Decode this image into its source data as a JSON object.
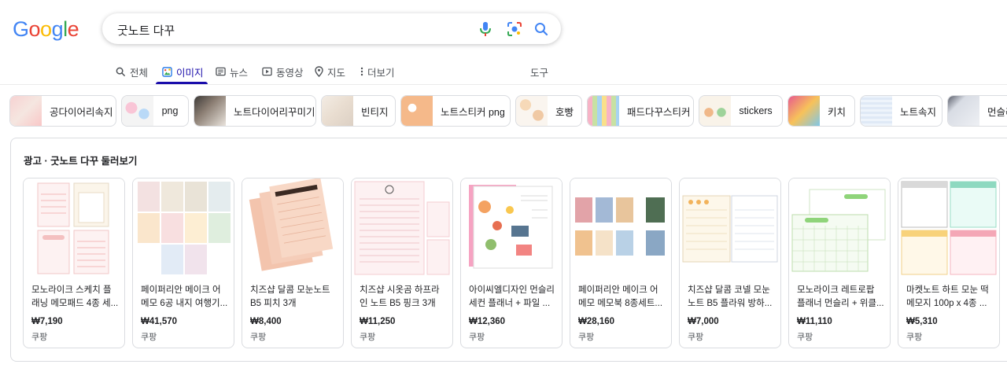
{
  "logo": {
    "text": "Google"
  },
  "search": {
    "query": "굿노트 다꾸"
  },
  "icons": {
    "mic": "microphone-icon",
    "lens": "camera-lens-icon",
    "search": "search-icon"
  },
  "tabs": [
    {
      "label": "전체",
      "icon": "search-icon"
    },
    {
      "label": "이미지",
      "icon": "image-icon",
      "active": true
    },
    {
      "label": "뉴스",
      "icon": "news-icon"
    },
    {
      "label": "동영상",
      "icon": "video-icon"
    },
    {
      "label": "지도",
      "icon": "map-pin-icon"
    },
    {
      "label": "더보기",
      "icon": "more-vert-icon"
    }
  ],
  "tools_label": "도구",
  "chips": [
    {
      "label": "공다이어리속지"
    },
    {
      "label": "png"
    },
    {
      "label": "노트다이어리꾸미기"
    },
    {
      "label": "빈티지"
    },
    {
      "label": "노트스티커 png"
    },
    {
      "label": "호빵"
    },
    {
      "label": "패드다꾸스티커"
    },
    {
      "label": "stickers"
    },
    {
      "label": "키치"
    },
    {
      "label": "노트속지"
    },
    {
      "label": "먼슬리"
    }
  ],
  "ads": {
    "title": "광고 · 굿노트 다꾸 둘러보기",
    "items": [
      {
        "title": "모노라이크 스케치 플래닝 메모패드 4종 세...",
        "price": "₩7,190",
        "seller": "쿠팡"
      },
      {
        "title": "페이퍼리안 메이크 어 메모 6공 내지 여행기...",
        "price": "₩41,570",
        "seller": "쿠팡"
      },
      {
        "title": "치즈샵 달콤 모눈노트 B5 피치 3개",
        "price": "₩8,400",
        "seller": "쿠팡"
      },
      {
        "title": "치즈샵 시옷곰 하프라인 노트 B5 핑크 3개",
        "price": "₩11,250",
        "seller": "쿠팡"
      },
      {
        "title": "아이씨엘디자인 먼슬리 세컨 플래너 + 파일 ...",
        "price": "₩12,360",
        "seller": "쿠팡"
      },
      {
        "title": "페이퍼리안 메이크 어 메모 메모북 8종세트...",
        "price": "₩28,160",
        "seller": "쿠팡"
      },
      {
        "title": "치즈샵 달콤 코넬 모눈노트 B5 플라워 방하...",
        "price": "₩7,000",
        "seller": "쿠팡"
      },
      {
        "title": "모노라이크 레트로팝 플래너 먼슬리 + 위클...",
        "price": "₩11,110",
        "seller": "쿠팡"
      },
      {
        "title": "마켓노트 하트 모눈 떡메모지 100p x 4종 ...",
        "price": "₩5,310",
        "seller": "쿠팡"
      }
    ]
  }
}
